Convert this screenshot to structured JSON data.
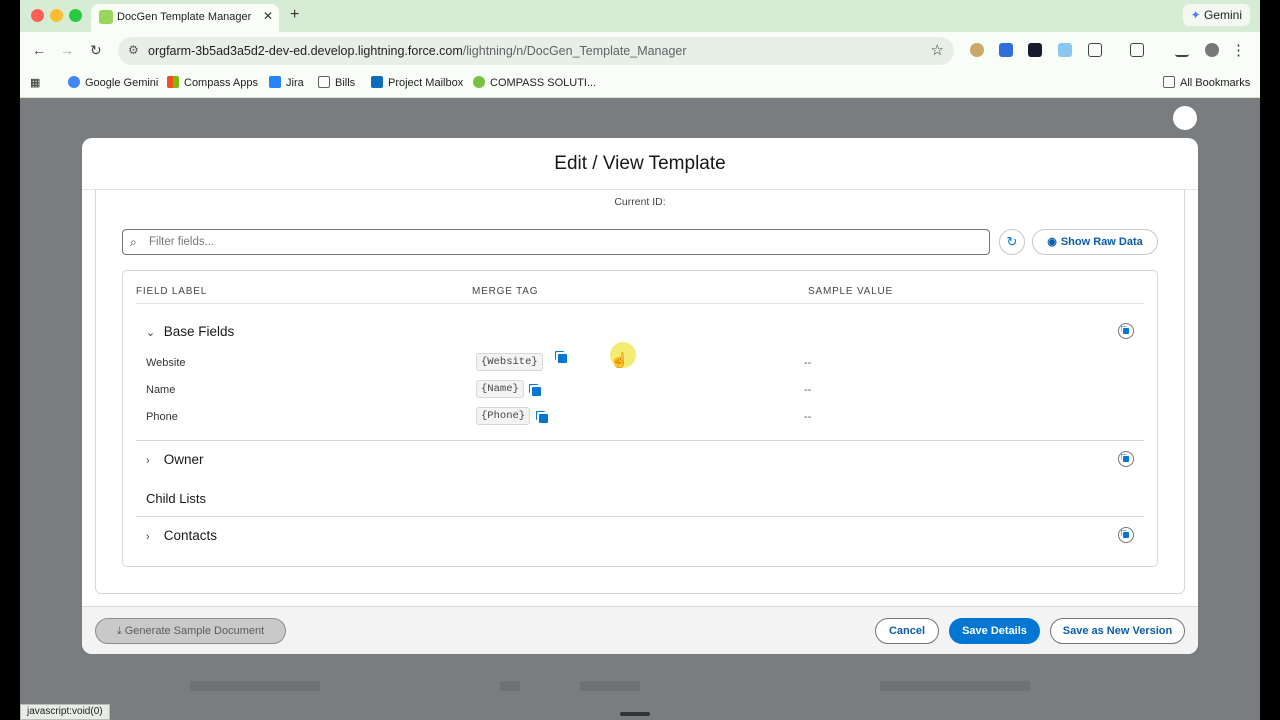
{
  "browser": {
    "tab_title": "DocGen Template Manager | S",
    "gemini_label": "Gemini",
    "url_host": "orgfarm-3b5ad3a5d2-dev-ed.develop.lightning.force.com",
    "url_path": "/lightning/n/DocGen_Template_Manager",
    "bookmarks": [
      {
        "label": "Google Gemini",
        "color": "#4285f4"
      },
      {
        "label": "Compass Apps",
        "color": "#f25022"
      },
      {
        "label": "Jira",
        "color": "#2684ff"
      },
      {
        "label": "Bills",
        "color": "#5f6368"
      },
      {
        "label": "Project Mailbox",
        "color": "#0f6cbd"
      },
      {
        "label": "COMPASS SOLUTI...",
        "color": "#7ac143"
      }
    ],
    "all_bookmarks": "All Bookmarks",
    "status_text": "javascript:void(0)"
  },
  "modal": {
    "title": "Edit / View Template",
    "current_id_label": "Current ID:",
    "filter_placeholder": "Filter fields...",
    "show_raw_data": "Show Raw Data",
    "columns": {
      "field_label": "FIELD LABEL",
      "merge_tag": "MERGE TAG",
      "sample_value": "SAMPLE VALUE"
    },
    "base_fields_title": "Base Fields",
    "fields": [
      {
        "label": "Website",
        "tag": "{Website}",
        "sample": "--"
      },
      {
        "label": "Name",
        "tag": "{Name}",
        "sample": "--"
      },
      {
        "label": "Phone",
        "tag": "{Phone}",
        "sample": "--"
      }
    ],
    "owner_title": "Owner",
    "child_lists_title": "Child Lists",
    "contacts_title": "Contacts",
    "footer": {
      "generate_sample": "Generate Sample Document",
      "cancel": "Cancel",
      "save_details": "Save Details",
      "save_new_version": "Save as New Version"
    }
  },
  "colors": {
    "brand_blue": "#0176d3",
    "link_blue": "#0b5cab"
  }
}
